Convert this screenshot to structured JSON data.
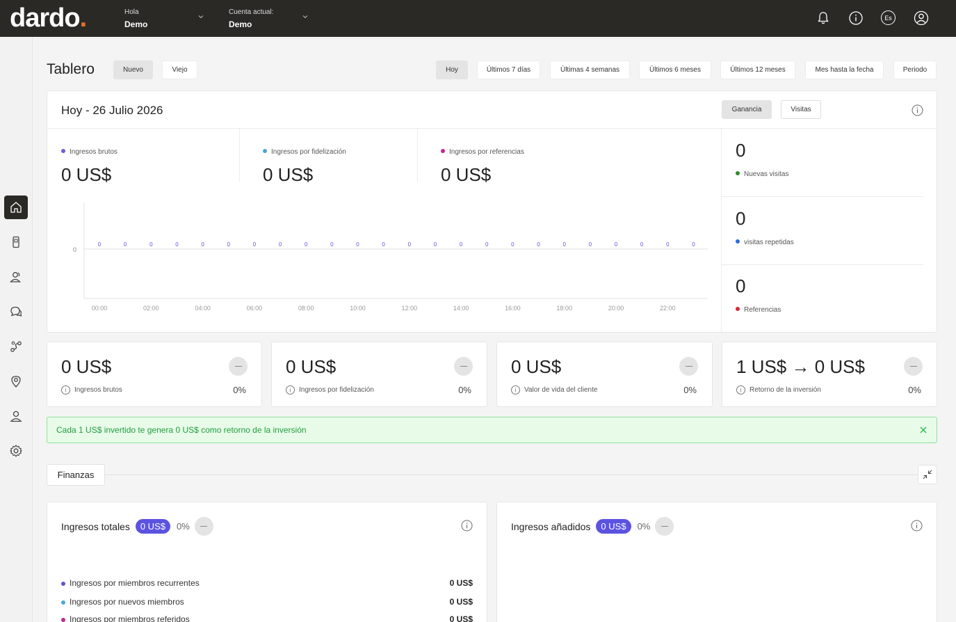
{
  "brand": {
    "name_part1": "da",
    "name_r": "r",
    "name_part2": "do",
    "name_dot": ".",
    "accent": "#e8702a"
  },
  "header": {
    "greeting_label": "Hola",
    "greeting_name": "Demo",
    "account_label": "Cuenta actual:",
    "account_name": "Demo",
    "language": "Es",
    "icons": [
      "bell-icon",
      "info-icon",
      "language-icon",
      "user-icon"
    ]
  },
  "sidebar": {
    "items": [
      {
        "name": "home-icon",
        "active": true
      },
      {
        "name": "device-icon",
        "active": false
      },
      {
        "name": "users-icon",
        "active": false
      },
      {
        "name": "chat-icon",
        "active": false
      },
      {
        "name": "route-icon",
        "active": false
      },
      {
        "name": "location-icon",
        "active": false
      },
      {
        "name": "profile-icon",
        "active": false
      },
      {
        "name": "settings-icon",
        "active": false
      }
    ]
  },
  "dashboard": {
    "title": "Tablero",
    "versions": [
      "Nuevo",
      "Viejo"
    ],
    "selected_version": "Nuevo",
    "ranges": [
      "Hoy",
      "Últimos 7 días",
      "Últimas 4 semanas",
      "Últimos 6 meses",
      "Últimos 12 meses",
      "Mes hasta la fecha",
      "Periodo"
    ],
    "selected_range": "Hoy"
  },
  "overview": {
    "title": "Hoy - 26 Julio 2026",
    "toggle": [
      "Ganancia",
      "Visitas"
    ],
    "selected_toggle": "Ganancia",
    "metrics": [
      {
        "label": "Ingresos brutos",
        "value": "0 US$",
        "color": "#6b5ce7"
      },
      {
        "label": "Ingresos por fidelización",
        "value": "0 US$",
        "color": "#4aa6d8"
      },
      {
        "label": "Ingresos por referencias",
        "value": "0 US$",
        "color": "#c2288a"
      }
    ],
    "side_stats": [
      {
        "value": "0",
        "label": "Nuevas visitas",
        "color": "#2e8b2e"
      },
      {
        "value": "0",
        "label": "visitas repetidas",
        "color": "#2a6fd6"
      },
      {
        "value": "0",
        "label": "Referencias",
        "color": "#d6283a"
      }
    ]
  },
  "chart_data": {
    "type": "line",
    "y_tick": "0",
    "x_ticks": [
      "00:00",
      "02:00",
      "04:00",
      "06:00",
      "08:00",
      "10:00",
      "12:00",
      "14:00",
      "16:00",
      "18:00",
      "20:00",
      "22:00"
    ],
    "x": [
      "00:00",
      "01:00",
      "02:00",
      "03:00",
      "04:00",
      "05:00",
      "06:00",
      "07:00",
      "08:00",
      "09:00",
      "10:00",
      "11:00",
      "12:00",
      "13:00",
      "14:00",
      "15:00",
      "16:00",
      "17:00",
      "18:00",
      "19:00",
      "20:00",
      "21:00",
      "22:00",
      "23:00"
    ],
    "values": [
      0,
      0,
      0,
      0,
      0,
      0,
      0,
      0,
      0,
      0,
      0,
      0,
      0,
      0,
      0,
      0,
      0,
      0,
      0,
      0,
      0,
      0,
      0,
      0
    ],
    "label_color": "#5b53e0"
  },
  "stats": [
    {
      "value": "0 US$",
      "label": "Ingresos brutos",
      "pct": "0%"
    },
    {
      "value": "0 US$",
      "label": "Ingresos por fidelización",
      "pct": "0%"
    },
    {
      "value": "0 US$",
      "label": "Valor de vida del cliente",
      "pct": "0%"
    },
    {
      "value": "1 US$ → 0 US$",
      "label": "Retorno de la inversión",
      "pct": "0%"
    }
  ],
  "banner": {
    "text": "Cada 1 US$ invertido te genera 0 US$ como retorno de la inversión"
  },
  "finance": {
    "section_label": "Finanzas",
    "total": {
      "title": "Ingresos totales",
      "badge": "0 US$",
      "pct": "0%",
      "rows": [
        {
          "label": "Ingresos por miembros recurrentes",
          "value": "0 US$",
          "color": "#5b53e0"
        },
        {
          "label": "Ingresos por nuevos miembros",
          "value": "0 US$",
          "color": "#4aa6d8"
        },
        {
          "label": "Ingresos por miembros referidos",
          "value": "0 US$",
          "color": "#c2288a"
        }
      ]
    },
    "added": {
      "title": "Ingresos añadidos",
      "badge": "0 US$",
      "pct": "0%"
    }
  }
}
